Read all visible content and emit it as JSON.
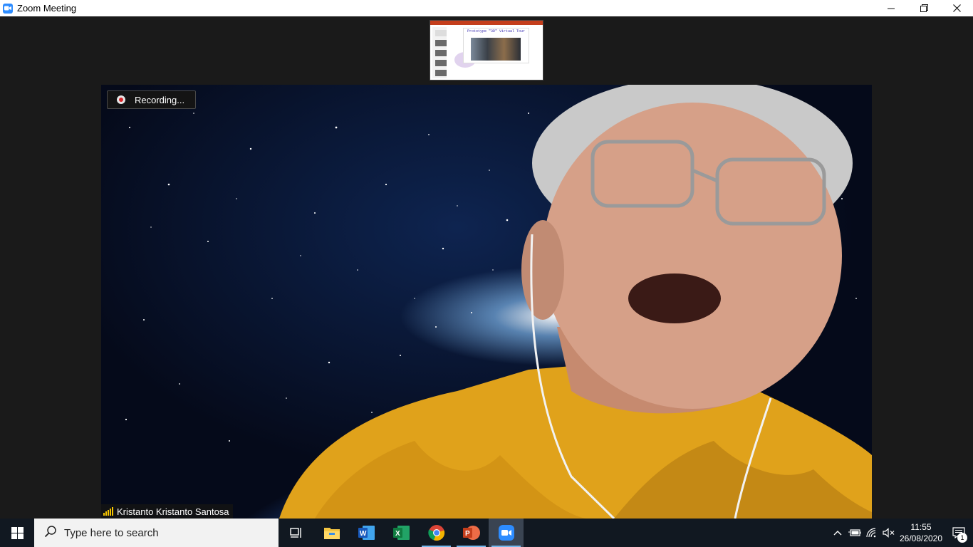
{
  "window": {
    "title": "Zoom Meeting",
    "controls": {
      "minimize": "—",
      "restore": "❐",
      "close": "✕"
    }
  },
  "meeting": {
    "recording_label": "Recording...",
    "participant_name": "Kristanto Kristanto Santosa",
    "shared_slide_title": "Prototype \"3D\" Virtual Tour"
  },
  "taskbar": {
    "search_placeholder": "Type here to search",
    "apps": [
      {
        "name": "task-view-icon"
      },
      {
        "name": "file-explorer-icon"
      },
      {
        "name": "word-icon"
      },
      {
        "name": "excel-icon"
      },
      {
        "name": "chrome-icon"
      },
      {
        "name": "powerpoint-icon"
      },
      {
        "name": "zoom-icon"
      }
    ],
    "time": "11:55",
    "date": "26/08/2020",
    "notification_count": "1"
  },
  "colors": {
    "zoom_blue": "#2d8cff",
    "taskbar": "#111821",
    "recording_red": "#d9262a",
    "signal_yellow": "#f5c400"
  }
}
